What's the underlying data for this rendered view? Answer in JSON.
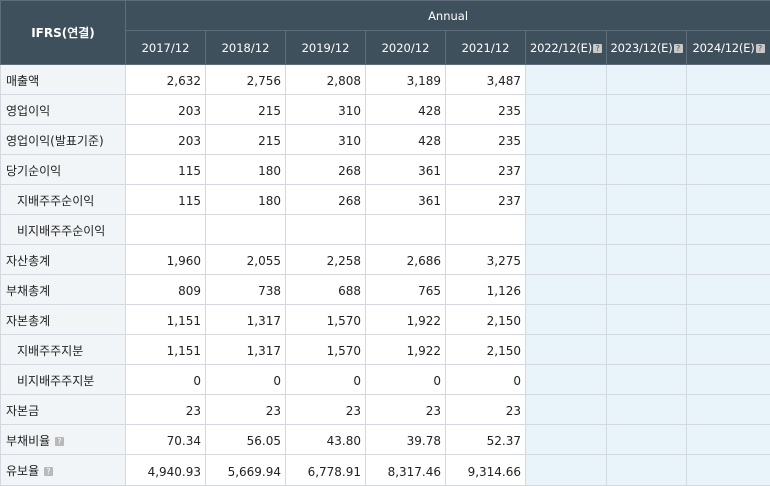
{
  "header": {
    "corner": "IFRS(연결)",
    "group": "Annual",
    "years": [
      "2017/12",
      "2018/12",
      "2019/12",
      "2020/12",
      "2021/12"
    ],
    "estimates": [
      "2022/12(E)",
      "2023/12(E)",
      "2024/12(E)"
    ],
    "help_glyph": "?"
  },
  "rows": [
    {
      "label": "매출액",
      "values": [
        "2,632",
        "2,756",
        "2,808",
        "3,189",
        "3,487"
      ]
    },
    {
      "label": "영업이익",
      "values": [
        "203",
        "215",
        "310",
        "428",
        "235"
      ]
    },
    {
      "label": "영업이익(발표기준)",
      "values": [
        "203",
        "215",
        "310",
        "428",
        "235"
      ]
    },
    {
      "label": "당기순이익",
      "values": [
        "115",
        "180",
        "268",
        "361",
        "237"
      ]
    },
    {
      "label": "지배주주순이익",
      "values": [
        "115",
        "180",
        "268",
        "361",
        "237"
      ]
    },
    {
      "label": "비지배주주순이익",
      "values": [
        "",
        "",
        "",
        "",
        ""
      ]
    },
    {
      "label": "자산총계",
      "values": [
        "1,960",
        "2,055",
        "2,258",
        "2,686",
        "3,275"
      ]
    },
    {
      "label": "부채총계",
      "values": [
        "809",
        "738",
        "688",
        "765",
        "1,126"
      ]
    },
    {
      "label": "자본총계",
      "values": [
        "1,151",
        "1,317",
        "1,570",
        "1,922",
        "2,150"
      ]
    },
    {
      "label": "지배주주지분",
      "values": [
        "1,151",
        "1,317",
        "1,570",
        "1,922",
        "2,150"
      ]
    },
    {
      "label": "비지배주주지분",
      "values": [
        "0",
        "0",
        "0",
        "0",
        "0"
      ]
    },
    {
      "label": "자본금",
      "values": [
        "23",
        "23",
        "23",
        "23",
        "23"
      ]
    },
    {
      "label": "부채비율",
      "values": [
        "70.34",
        "56.05",
        "43.80",
        "39.78",
        "52.37"
      ]
    },
    {
      "label": "유보율",
      "values": [
        "4,940.93",
        "5,669.94",
        "6,778.91",
        "8,317.46",
        "9,314.66"
      ]
    }
  ],
  "help_icon": "question-mark-icon"
}
